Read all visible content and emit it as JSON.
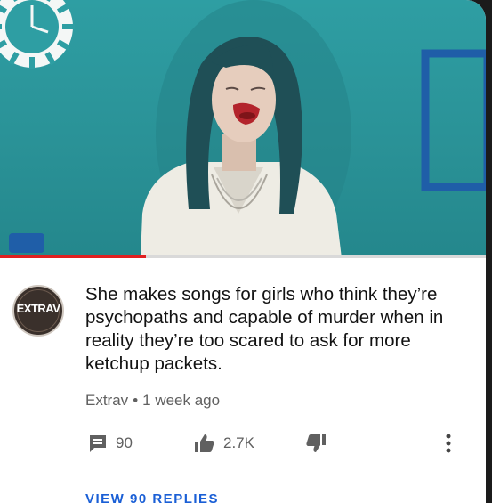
{
  "comment": {
    "avatar_text": "EXTRAV",
    "text": "She makes songs for girls who think they’re psychopaths and capable of murder when in reality they’re too scared to ask for more ketchup packets.",
    "author": "Extrav",
    "separator": "•",
    "time": "1 week ago"
  },
  "actions": {
    "replies_count": "90",
    "likes_count": "2.7K"
  },
  "replies_link": "VIEW 90 REPLIES",
  "video": {
    "progress_fraction": 0.3
  },
  "colors": {
    "video_background": "#2a9297",
    "progress": "#e02020",
    "link": "#1a5fd6"
  }
}
